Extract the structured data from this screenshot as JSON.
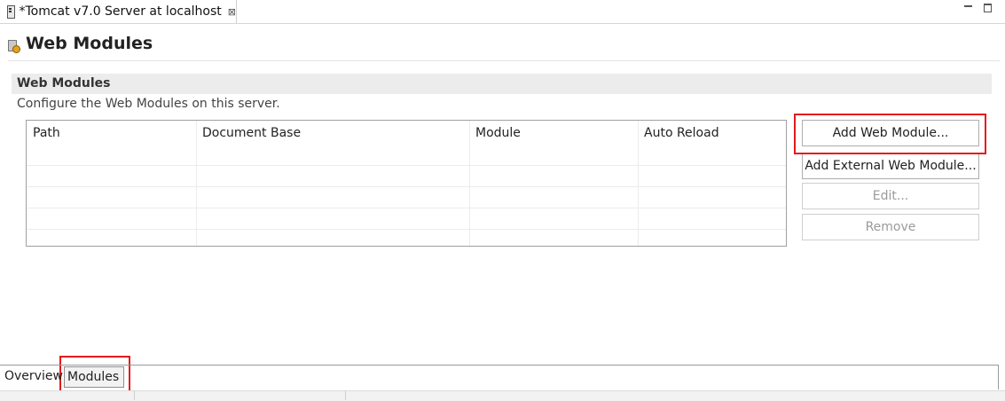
{
  "editor_tab": {
    "title": "*Tomcat v7.0 Server at localhost",
    "close_glyph": "⊠",
    "icon": "server-file-icon"
  },
  "window_controls": {
    "minimize_icon": "minimize-icon",
    "maximize_icon": "maximize-icon"
  },
  "header": {
    "title": "Web Modules",
    "icon": "web-module-icon"
  },
  "section": {
    "title": "Web Modules",
    "description": "Configure the Web Modules on this server."
  },
  "table": {
    "columns": [
      "Path",
      "Document Base",
      "Module",
      "Auto Reload"
    ],
    "rows": []
  },
  "buttons": {
    "add_web_module": "Add Web Module...",
    "add_external_web_module": "Add External Web Module...",
    "edit": "Edit...",
    "remove": "Remove"
  },
  "bottom_tabs": {
    "overview": "Overview",
    "modules": "Modules"
  },
  "colors": {
    "highlight": "#e41a1a",
    "section_bg": "#ececec",
    "disabled_text": "#9a9a9a"
  }
}
